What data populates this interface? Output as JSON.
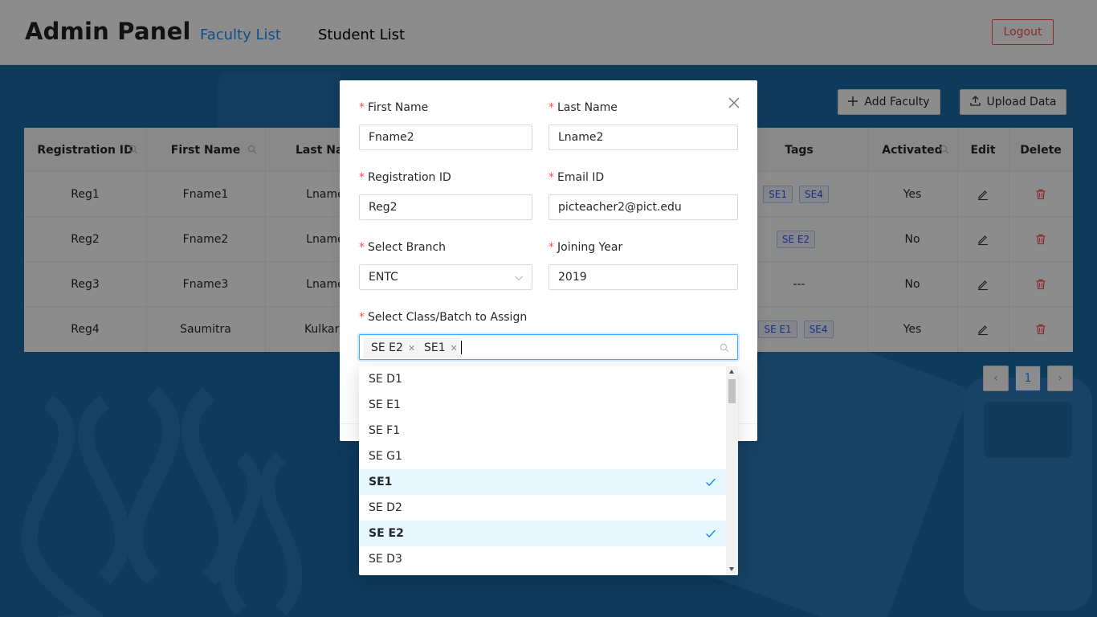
{
  "header": {
    "brand": "Admin Panel",
    "nav": [
      {
        "label": "Faculty List",
        "active": true
      },
      {
        "label": "Student List",
        "active": false
      }
    ],
    "logout_label": "Logout"
  },
  "actions": {
    "add_faculty_label": "Add Faculty",
    "upload_data_label": "Upload Data"
  },
  "table": {
    "columns": [
      "Registration ID",
      "First Name",
      "Last Nam",
      "Tags",
      "Activated",
      "Edit",
      "Delete"
    ],
    "rows": [
      {
        "reg_id": "Reg1",
        "first_name": "Fname1",
        "last_name": "Lname",
        "tags": [
          "SE1",
          "SE4"
        ],
        "activated": "Yes"
      },
      {
        "reg_id": "Reg2",
        "first_name": "Fname2",
        "last_name": "Lname",
        "tags": [
          "SE E2"
        ],
        "activated": "No"
      },
      {
        "reg_id": "Reg3",
        "first_name": "Fname3",
        "last_name": "Lname",
        "tags_text": "---",
        "activated": "No"
      },
      {
        "reg_id": "Reg4",
        "first_name": "Saumitra",
        "last_name": "Kulkarn",
        "tags": [
          "SE E1",
          "SE4"
        ],
        "activated": "Yes"
      }
    ]
  },
  "pagination": {
    "prev": "‹",
    "current": "1",
    "next": "›"
  },
  "modal": {
    "first_name": {
      "label": "First Name",
      "value": "Fname2"
    },
    "last_name": {
      "label": "Last Name",
      "value": "Lname2"
    },
    "registration_id": {
      "label": "Registration ID",
      "value": "Reg2"
    },
    "email_id": {
      "label": "Email ID",
      "value": "picteacher2@pict.edu"
    },
    "branch": {
      "label": "Select Branch",
      "value": "ENTC"
    },
    "joining_year": {
      "label": "Joining Year",
      "value": "2019"
    },
    "assign": {
      "label": "Select Class/Batch to Assign",
      "selected_tags": [
        "SE E2",
        "SE1"
      ]
    },
    "required_mark": "*"
  },
  "dropdown": {
    "options": [
      {
        "label": "SE D1",
        "selected": false
      },
      {
        "label": "SE E1",
        "selected": false
      },
      {
        "label": "SE F1",
        "selected": false
      },
      {
        "label": "SE G1",
        "selected": false
      },
      {
        "label": "SE1",
        "selected": true
      },
      {
        "label": "SE D2",
        "selected": false
      },
      {
        "label": "SE E2",
        "selected": true
      },
      {
        "label": "SE D3",
        "selected": false
      }
    ]
  },
  "colors": {
    "primary": "#1890ff",
    "danger": "#ff4d4f",
    "background": "#1b6aa8",
    "tag_text": "#2f54eb",
    "selected_option_bg": "#e6f7ff"
  }
}
